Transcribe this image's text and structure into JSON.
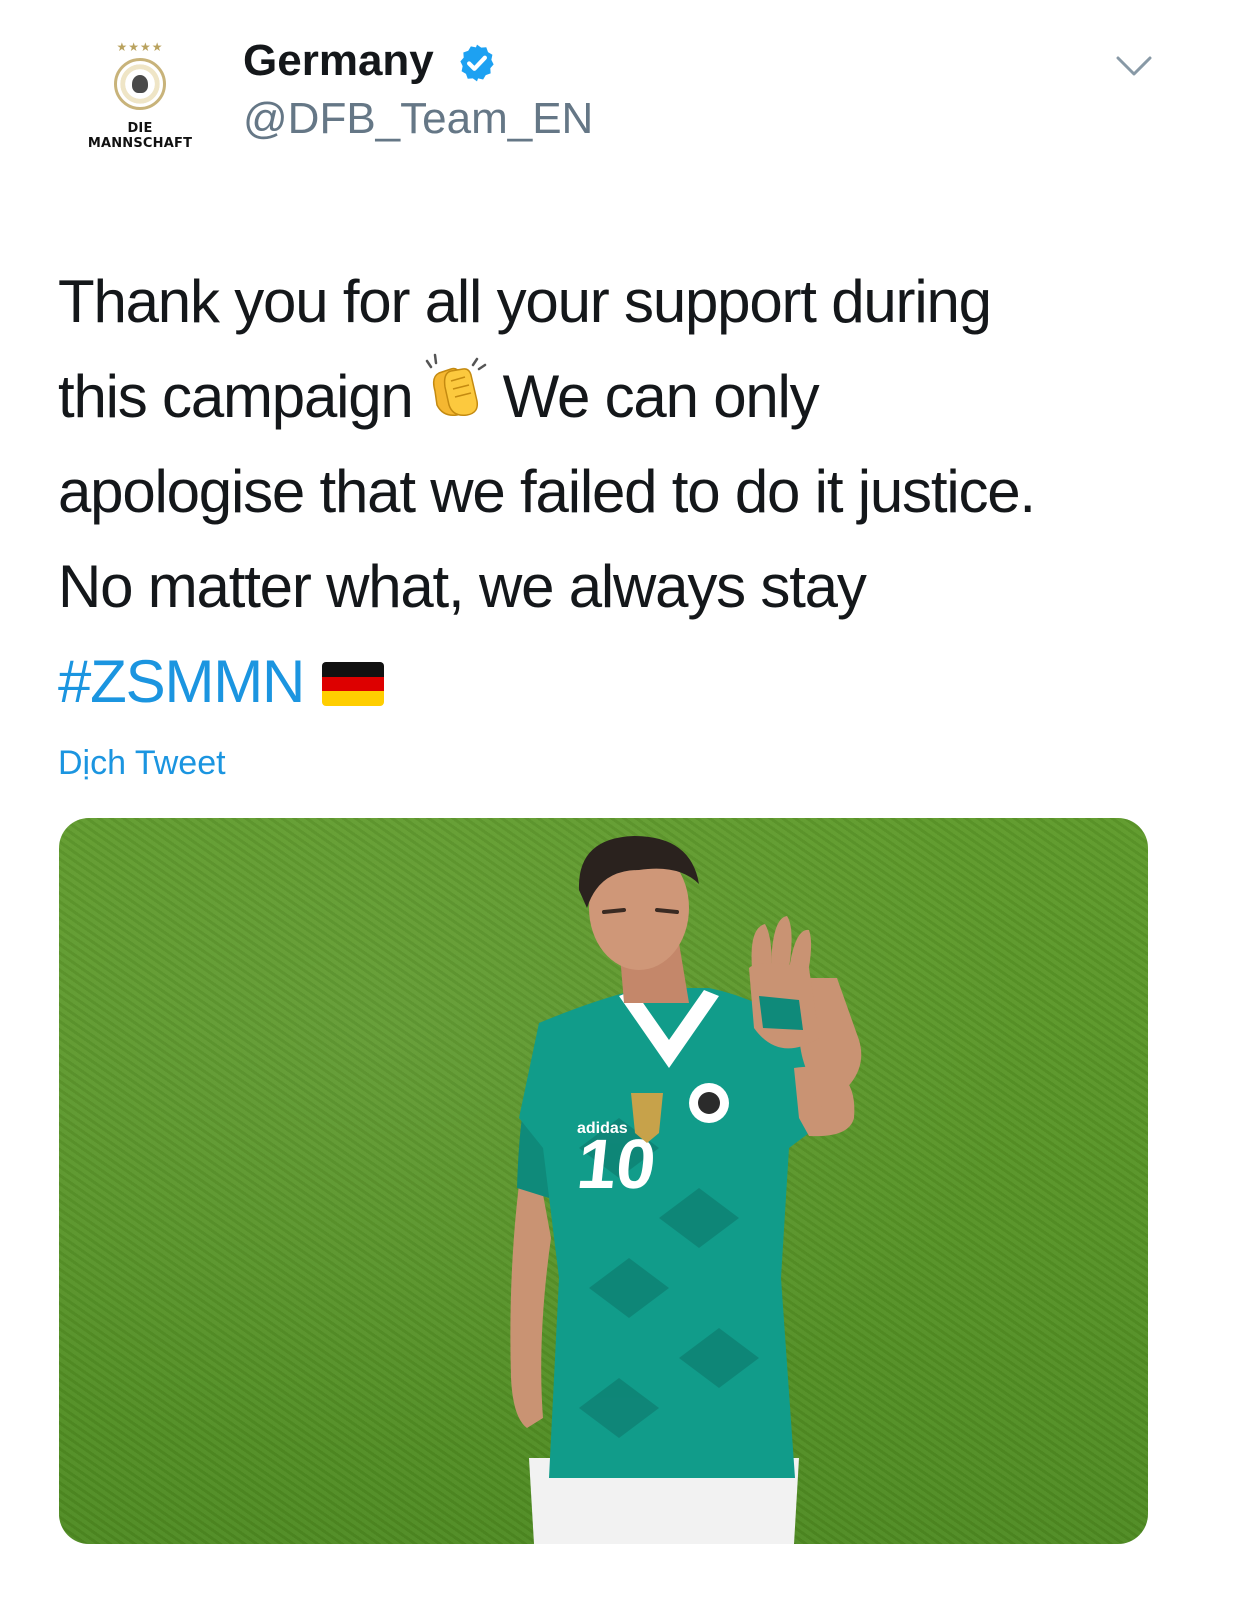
{
  "tweet": {
    "author": {
      "display_name": "Germany",
      "handle": "@DFB_Team_EN",
      "avatar_text": "DIE MANNSCHAFT",
      "verified": true
    },
    "text_lines": [
      "Thank you for all your support during",
      "this campaign",
      "We can only",
      "apologise that we failed to do it justice.",
      "No matter what, we always stay"
    ],
    "hashtag": "#ZSMMN",
    "translate_label": "Dịch Tweet",
    "media": {
      "jersey_number": "10",
      "jersey_brand": "adidas"
    }
  },
  "colors": {
    "link": "#1b95e0",
    "text": "#14171a",
    "secondary": "#657786",
    "verified": "#1da1f2"
  },
  "icons": [
    "verified-badge-icon",
    "chevron-down-icon",
    "clapping-hands-emoji",
    "germany-flag-emoji"
  ]
}
